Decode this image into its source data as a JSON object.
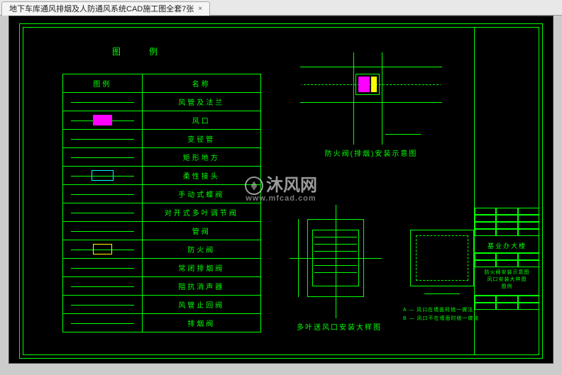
{
  "tab": {
    "title": "地下车库通风排烟及人防通风系统CAD施工图全套7张",
    "close": "×"
  },
  "legend": {
    "title": "图例",
    "header_symbol": "图例",
    "header_name": "名称",
    "rows": [
      "风管及法兰",
      "风口",
      "变径管",
      "矩形地方",
      "柔性接头",
      "手动式蝶阀",
      "对开式多叶调节阀",
      "管阀",
      "防火阀",
      "常闭排烟阀",
      "阻抗消声器",
      "风管止回阀",
      "排烟阀"
    ]
  },
  "details": {
    "d1_caption": "防火阀(排烟)安装示意图",
    "d2_caption": "多叶送风口安装大样图",
    "d3_note_a": "A — 风口在墙面时统一做法",
    "d3_note_b": "B — 风口不在墙面时统一做法"
  },
  "title_block": {
    "project": "基业办大楼",
    "drawing_title": "防火阀安装示意图\n风口安装大样图\n图例"
  },
  "watermark": {
    "text": "沐风网",
    "url": "www.mfcad.com"
  }
}
